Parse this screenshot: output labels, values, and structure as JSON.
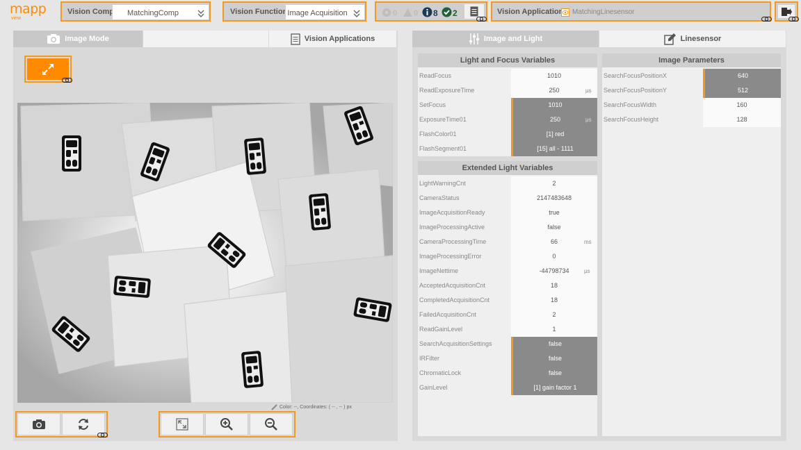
{
  "logo": {
    "brand": "mapp",
    "sub": "view"
  },
  "header": {
    "component_label": "Vision Component:",
    "component_value": "MatchingComp",
    "function_label": "Vision Function:",
    "function_value": "Image Acquisition",
    "status": {
      "gear_count": "0",
      "warning_count": "0",
      "info_count": "8",
      "ok_count": "2"
    },
    "application_label": "Vision Application:",
    "application_value": "MatchingLinesensor"
  },
  "left_tabs": [
    {
      "label": "Image Mode",
      "icon": "camera-icon",
      "active": true
    },
    {
      "label": "",
      "active": false
    },
    {
      "label": "Vision Applications",
      "icon": "document-icon",
      "active": false
    }
  ],
  "coordinates_text": "Color:      --, Coordinates: (       -- ,      -- ) px",
  "right_tabs": [
    {
      "label": "Image and Light",
      "icon": "sliders-icon",
      "active": true
    },
    {
      "label": "Linesensor",
      "icon": "edit-icon",
      "active": false
    }
  ],
  "light_focus": {
    "title": "Light and Focus Variables",
    "rows": [
      {
        "label": "ReadFocus",
        "value": "1010",
        "unit": "",
        "editable": false
      },
      {
        "label": "ReadExposureTime",
        "value": "250",
        "unit": "µs",
        "editable": false
      },
      {
        "label": "SetFocus",
        "value": "1010",
        "unit": "",
        "editable": true
      },
      {
        "label": "ExposureTime01",
        "value": "250",
        "unit": "µs",
        "editable": true
      },
      {
        "label": "FlashColor01",
        "value": "[1] red",
        "unit": "",
        "editable": true
      },
      {
        "label": "FlashSegment01",
        "value": "[15] all - 1111",
        "unit": "",
        "editable": true
      }
    ]
  },
  "extended_light": {
    "title": "Extended Light Variables",
    "rows": [
      {
        "label": "LightWarningCnt",
        "value": "2",
        "unit": "",
        "editable": false
      },
      {
        "label": "CameraStatus",
        "value": "2147483648",
        "unit": "",
        "editable": false
      },
      {
        "label": "ImageAcquisitionReady",
        "value": "true",
        "unit": "",
        "editable": false
      },
      {
        "label": "ImageProcessingActive",
        "value": "false",
        "unit": "",
        "editable": false
      },
      {
        "label": "CameraProcessingTime",
        "value": "66",
        "unit": "ms",
        "editable": false
      },
      {
        "label": "ImageProcessingError",
        "value": "0",
        "unit": "",
        "editable": false
      },
      {
        "label": "ImageNettime",
        "value": "-44798734",
        "unit": "µs",
        "editable": false
      },
      {
        "label": "AcceptedAcquisitionCnt",
        "value": "18",
        "unit": "",
        "editable": false
      },
      {
        "label": "CompletedAcquisitionCnt",
        "value": "18",
        "unit": "",
        "editable": false
      },
      {
        "label": "FailedAcquisitionCnt",
        "value": "2",
        "unit": "",
        "editable": false
      },
      {
        "label": "ReadGainLevel",
        "value": "1",
        "unit": "",
        "editable": false
      },
      {
        "label": "SearchAcquisitionSettings",
        "value": "false",
        "unit": "",
        "editable": true
      },
      {
        "label": "IRFilter",
        "value": "false",
        "unit": "",
        "editable": true
      },
      {
        "label": "ChromaticLock",
        "value": "false",
        "unit": "",
        "editable": true
      },
      {
        "label": "GainLevel",
        "value": "[1] gain factor 1",
        "unit": "",
        "editable": true
      }
    ]
  },
  "image_params": {
    "title": "Image Parameters",
    "rows": [
      {
        "label": "SearchFocusPositionX",
        "value": "640",
        "unit": "",
        "editable": true
      },
      {
        "label": "SearchFocusPositionY",
        "value": "512",
        "unit": "",
        "editable": true
      },
      {
        "label": "SearchFocusWidth",
        "value": "160",
        "unit": "",
        "editable": false
      },
      {
        "label": "SearchFocusHeight",
        "value": "128",
        "unit": "",
        "editable": false
      }
    ]
  },
  "colors": {
    "accent": "#f39a1e",
    "panel": "#d9d9d9",
    "editable": "#8a8a8a",
    "status_dark": "#1b3a57",
    "ok_green": "#1f5f3a"
  }
}
